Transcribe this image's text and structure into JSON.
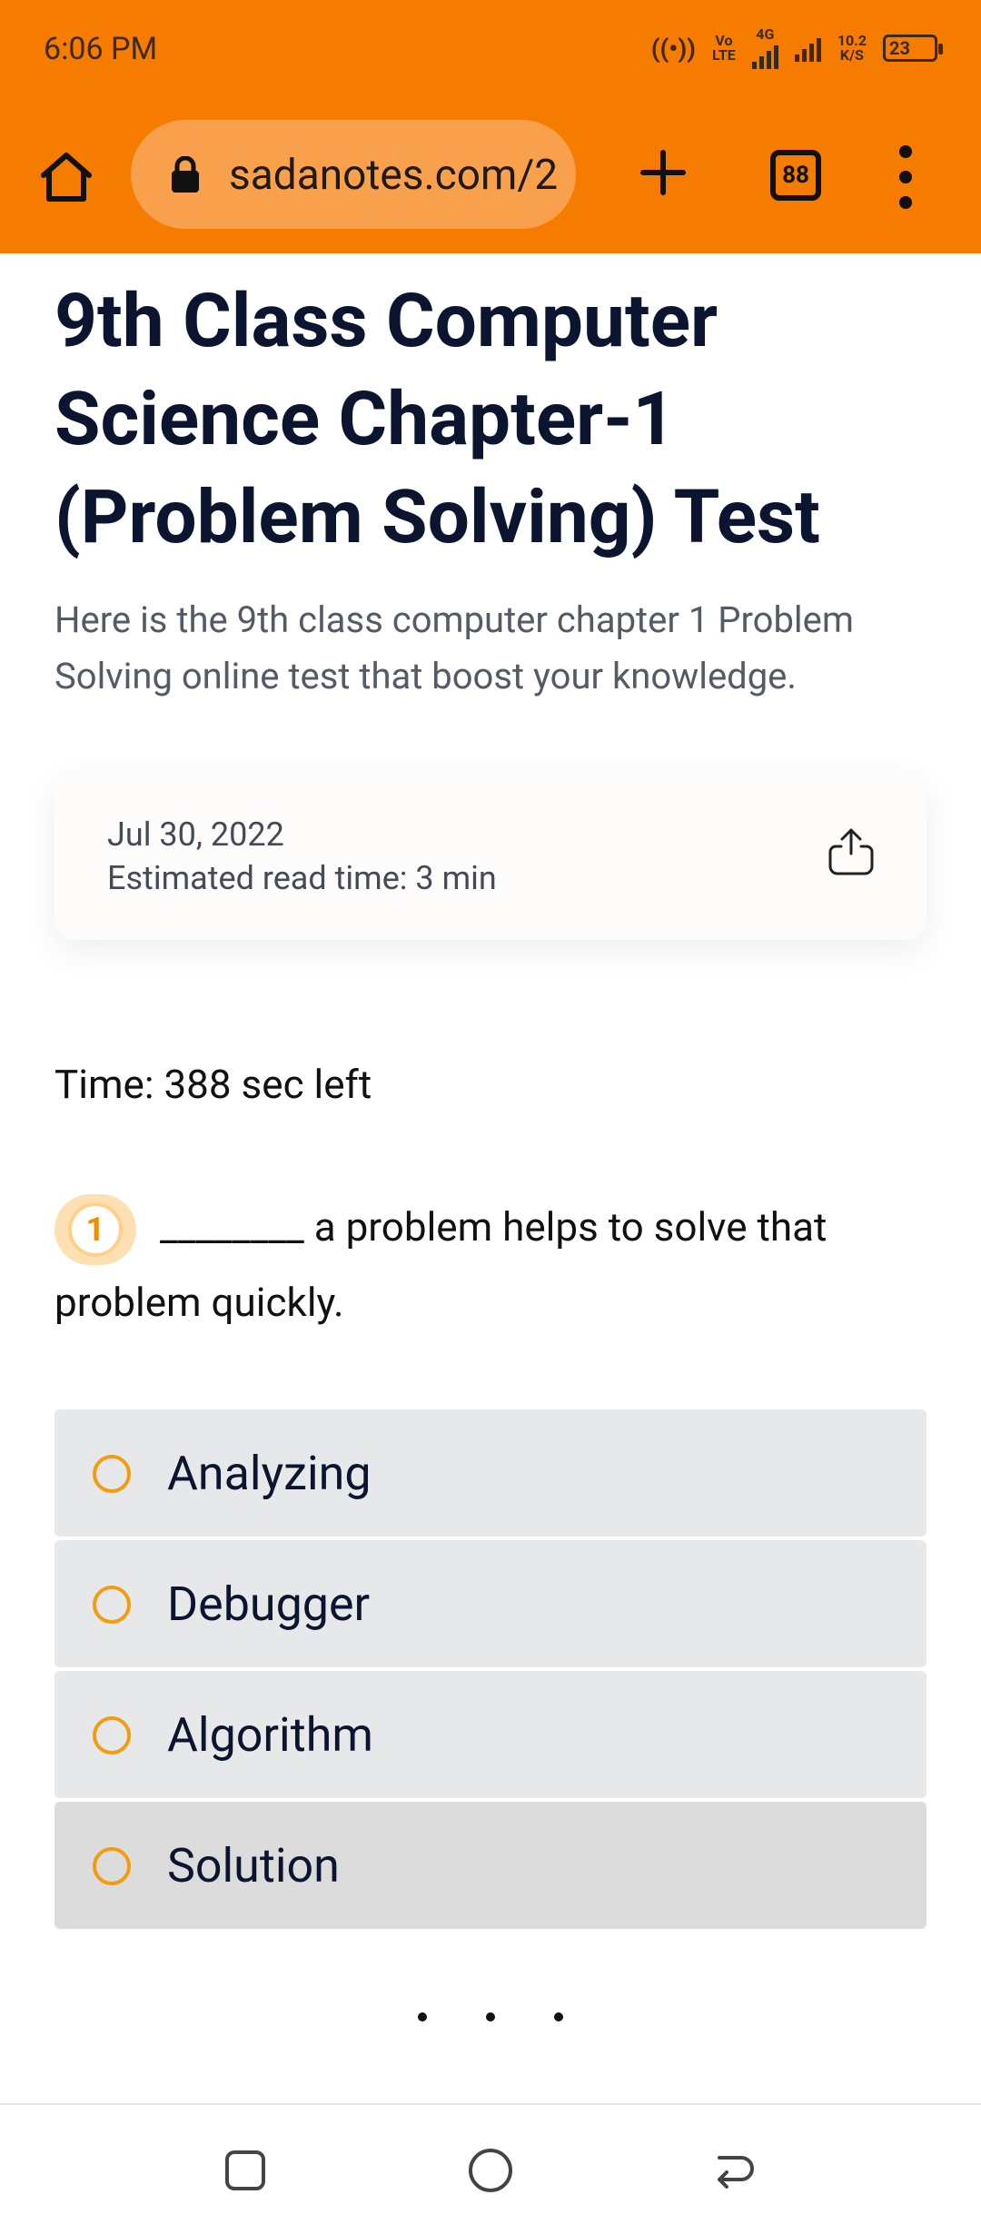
{
  "status_bar": {
    "time": "6:06 PM",
    "volte_top": "Vo",
    "volte_bottom": "LTE",
    "network": "4G",
    "speed_top": "10.2",
    "speed_bottom": "K/S",
    "battery": "23"
  },
  "browser": {
    "url": "sadanotes.com/2",
    "tab_count": "88"
  },
  "article": {
    "title": "9th Class Computer Science Chapter-1 (Problem Solving) Test",
    "subtitle": "Here is the 9th class computer chapter 1 Problem Solving online test that boost your knowledge.",
    "date": "Jul 30, 2022",
    "read_time": "Estimated read time: 3 min"
  },
  "quiz": {
    "timer": "Time: 388 sec left",
    "question_number": "1",
    "question_text": "________ a problem helps to solve that problem quickly.",
    "options": [
      {
        "label": "Analyzing"
      },
      {
        "label": "Debugger"
      },
      {
        "label": "Algorithm"
      },
      {
        "label": "Solution"
      }
    ]
  },
  "icons": {
    "accent": "#f57c00",
    "radio_color": "#f39c12"
  }
}
